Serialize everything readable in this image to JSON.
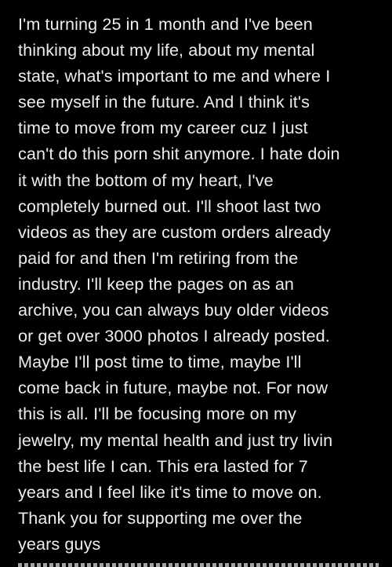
{
  "post": {
    "lines": [
      "I'm turning 25 in 1 month and I've been",
      "thinking about my life, about my mental",
      "state, what's important to me and where I",
      "see myself in the future. And I think it's",
      "time to move from my career cuz I just",
      "can't do this porn shit anymore. I hate doin",
      "it with the bottom of my heart, I've",
      "completely burned out. I'll shoot last two",
      "videos as they are custom orders already",
      "paid for and then I'm retiring from the",
      "industry. I'll keep the pages on as an",
      "archive, you can always buy older videos",
      "or get over 3000 photos I already posted.",
      "Maybe I'll post time to time, maybe I'll",
      "come back in future, maybe not. For now",
      "this is all. I'll be focusing more on my",
      "jewelry, my mental health and just try livin",
      "the best life I can. This era lasted for 7",
      "years and I feel like it's time to move on.",
      "Thank you for supporting me over the",
      "years guys"
    ]
  },
  "colors": {
    "background": "#000000",
    "text": "#ededed"
  }
}
